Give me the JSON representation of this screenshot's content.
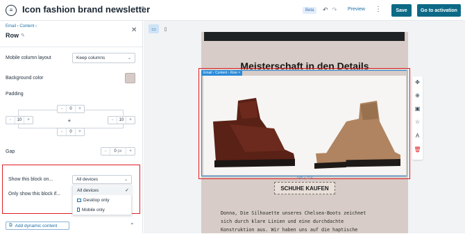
{
  "header": {
    "title": "Icon fashion brand newsletter",
    "beta": "Beta",
    "preview": "Preview",
    "save": "Save",
    "activation": "Go to activation"
  },
  "panel": {
    "breadcrumb": "Email › Content ›",
    "title": "Row",
    "mobile_layout_label": "Mobile column layout",
    "mobile_layout_value": "Keep columns",
    "bg_color_label": "Background color",
    "bg_color": "#d6cbc6",
    "padding_label": "Padding",
    "padding": {
      "top": "0",
      "left": "10",
      "right": "10",
      "bottom": "0"
    },
    "gap_label": "Gap",
    "gap_value": "0",
    "gap_unit": "px",
    "show_block_label": "Show this block on...",
    "show_block_value": "All devices",
    "only_show_label": "Only show this block if...",
    "device_options": [
      "All devices",
      "Desktop only",
      "Mobile only"
    ],
    "dynamic_content": "Add dynamic content"
  },
  "canvas": {
    "headline": "Meisterschaft in den Details",
    "row_tag": "Email › Content › Row ×",
    "dimensions": "648 × 314",
    "cta": "SCHUHE KAUFEN",
    "body_lines": [
      "Donna, Die Silhouette unseres Chelsea-Boots zeichnet",
      "sich durch klare Linien und eine durchdachte",
      "Konstruktion aus. Wir haben uns auf die haptische"
    ],
    "colors": {
      "email_bg": "#d7ccc7",
      "accent": "#0c6a86",
      "highlight": "#e01d23"
    }
  }
}
